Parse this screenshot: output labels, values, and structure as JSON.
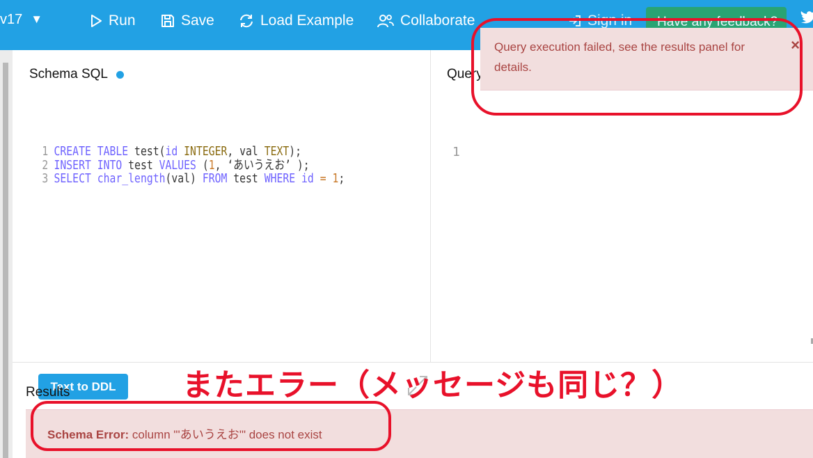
{
  "header": {
    "version_label": "v17",
    "version_caret": "▼",
    "run_label": "Run",
    "save_label": "Save",
    "load_label": "Load Example",
    "collab_label": "Collaborate",
    "signin_label": "Sign in",
    "feedback_label": "Have any feedback?"
  },
  "schema_panel": {
    "title": "Schema SQL",
    "lines": [
      {
        "no": "1",
        "t1": "CREATE",
        "t2": " ",
        "t3": "TABLE",
        "t4": " test(",
        "t5": "id",
        "t6": " ",
        "t7": "INTEGER",
        "t8": ", val ",
        "t9": "TEXT",
        "t10": ");"
      },
      {
        "no": "2",
        "t1": "INSERT",
        "t2": " ",
        "t3": "INTO",
        "t4": " test ",
        "t5": "VALUES",
        "t6": " (",
        "t7": "1",
        "t8": ", ‘あいうえお’ );"
      },
      {
        "no": "3",
        "t1": "SELECT",
        "t2": " ",
        "t3": "char_length",
        "t4": "(val) ",
        "t5": "FROM",
        "t6": " test ",
        "t7": "WHERE",
        "t8": " ",
        "t9": "id",
        "t10": " = ",
        "t11": "1",
        "t12": ";"
      }
    ],
    "ddl_button": "Text to DDL"
  },
  "query_panel": {
    "title": "Query SQL",
    "line_no": "1"
  },
  "results": {
    "title": "Results",
    "error_label": "Schema Error:",
    "error_message": " column \"'あいうえお'\" does not exist"
  },
  "toast": {
    "message": "Query execution failed, see the results panel for details.",
    "close": "×"
  },
  "annotation": {
    "text": "またエラー（メッセージも同じ？）"
  },
  "colors": {
    "topbar": "#22a1e4",
    "error_bg": "#f2dede",
    "error_text": "#a94442",
    "annotation": "#e8112a",
    "feedback_button": "#2aa567"
  }
}
